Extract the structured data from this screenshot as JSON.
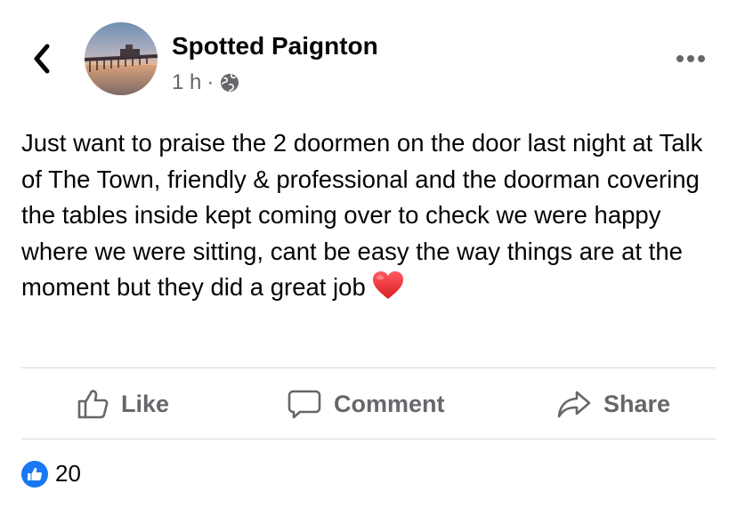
{
  "header": {
    "page_name": "Spotted Paignton",
    "time": "1 h",
    "separator": "·",
    "audience_icon": "globe-icon",
    "back_icon": "chevron-left-icon",
    "more_icon": "more-horizontal-icon"
  },
  "post": {
    "text": "Just want to praise the 2 doormen on the door last night at Talk of The Town, friendly & professional and the doorman covering the tables inside kept coming over to check we were happy where we were sitting, cant be easy the way things are at the moment but they did a great job",
    "emoji": "heart-emoji"
  },
  "actions": {
    "like_label": "Like",
    "comment_label": "Comment",
    "share_label": "Share"
  },
  "reactions": {
    "type": "like",
    "count": "20"
  },
  "colors": {
    "text": "#050505",
    "secondary": "#65676b",
    "divider": "#d6d8dc",
    "brand_blue": "#1877f2",
    "heart_red": "#e0262d"
  }
}
